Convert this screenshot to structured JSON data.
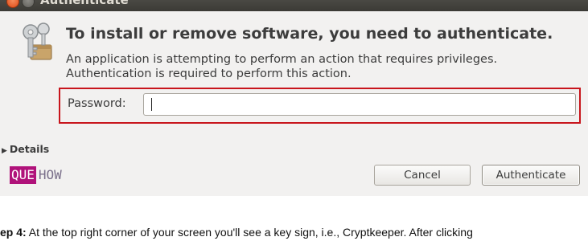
{
  "window": {
    "title": "Authenticate"
  },
  "dialog": {
    "heading": "To install or remove software, you need to authenticate.",
    "message_line1": "An application is attempting to perform an action that requires privileges.",
    "message_line2": "Authentication is required to perform this action.",
    "password_label": "Password:",
    "password_value": "",
    "details_label": "Details",
    "cancel_label": "Cancel",
    "authenticate_label": "Authenticate",
    "highlight_color": "#c8151c"
  },
  "watermark": {
    "part1": "QUE",
    "part2": "HOW",
    "color1": "#b0127a",
    "color2": "#7a6f8a"
  },
  "caption": {
    "step": "ep 4:",
    "text": " At the top right corner of your screen you'll see a key sign, i.e., Cryptkeeper. After clicking"
  }
}
